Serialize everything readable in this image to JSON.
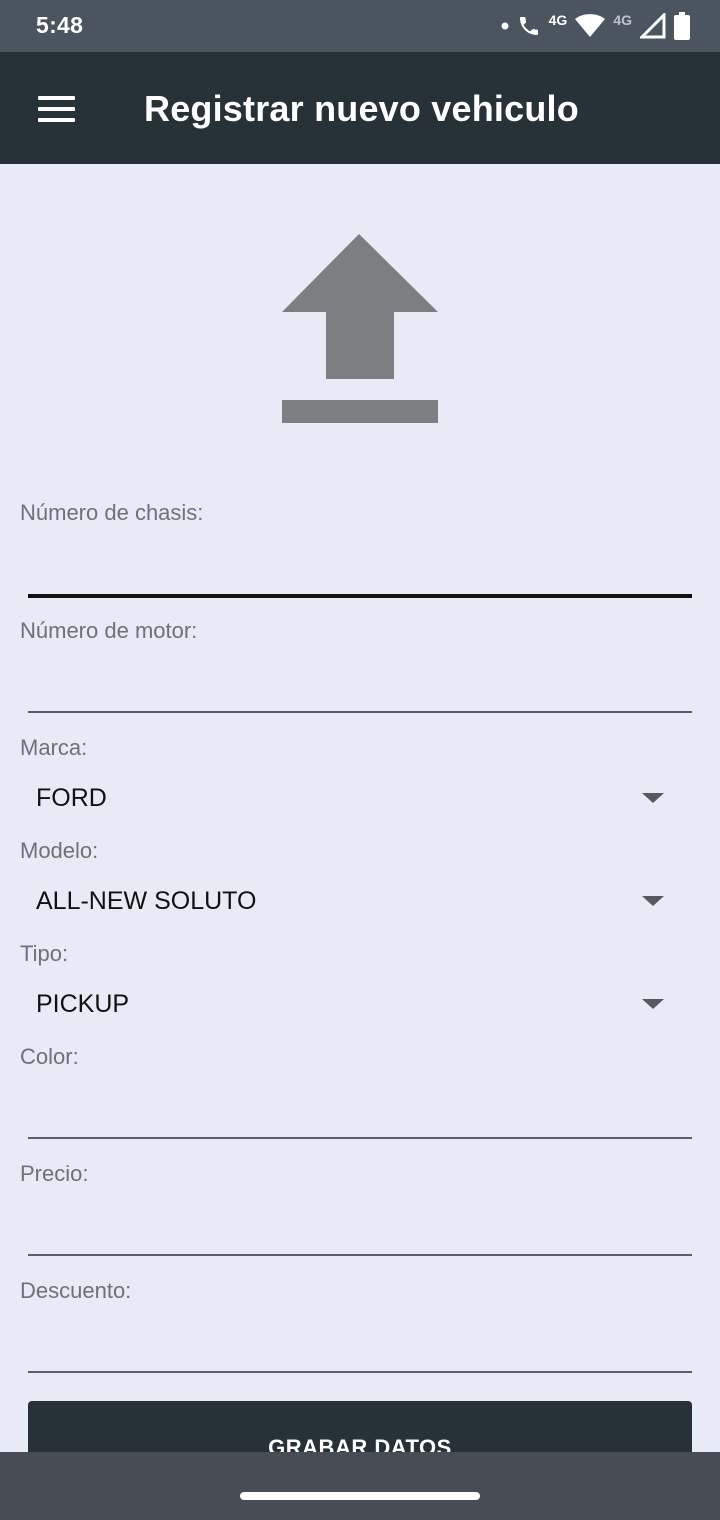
{
  "status_bar": {
    "time": "5:48",
    "network_label_1": "4G",
    "network_label_2": "4G",
    "icons": [
      "notification-dot-icon",
      "call-4g-icon",
      "wifi-icon",
      "signal-icon",
      "battery-icon"
    ]
  },
  "app_bar": {
    "title": "Registrar nuevo vehiculo",
    "menu_icon": "hamburger-menu-icon"
  },
  "upload": {
    "icon": "upload-arrow-icon"
  },
  "form": {
    "chasis": {
      "label": "Número de chasis:",
      "value": ""
    },
    "motor": {
      "label": "Número de motor:",
      "value": ""
    },
    "marca": {
      "label": "Marca:",
      "selected": "FORD"
    },
    "modelo": {
      "label": "Modelo:",
      "selected": "ALL-NEW SOLUTO"
    },
    "tipo": {
      "label": "Tipo:",
      "selected": "PICKUP"
    },
    "color": {
      "label": "Color:",
      "value": ""
    },
    "precio": {
      "label": "Precio:",
      "value": ""
    },
    "descuento": {
      "label": "Descuento:",
      "value": ""
    },
    "save_label": "GRABAR DATOS"
  },
  "colors": {
    "status_bar": "#4a555f",
    "app_bar": "#263238",
    "background": "#e8eaf6",
    "button": "#263238",
    "nav_bar": "#464d55",
    "icon_gray": "#7d7e82"
  }
}
